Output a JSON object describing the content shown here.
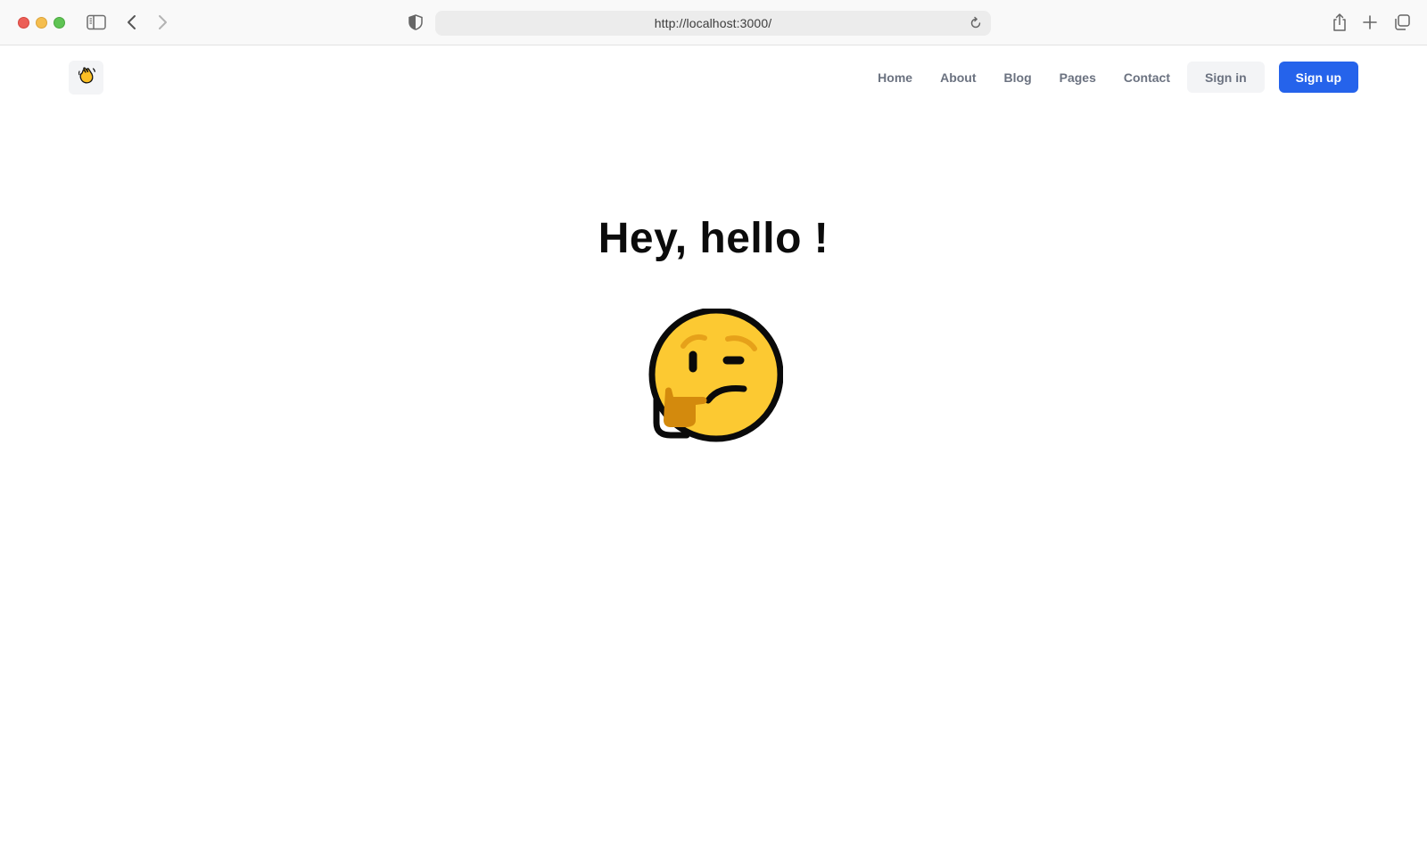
{
  "browser": {
    "url": "http://localhost:3000/",
    "icons": [
      "sidebar-toggle-icon",
      "back-icon",
      "forward-icon",
      "shield-icon",
      "reload-icon",
      "share-icon",
      "new-tab-icon",
      "tabs-overview-icon"
    ]
  },
  "header": {
    "logo_icon": "waving-hand-icon",
    "nav": [
      {
        "label": "Home"
      },
      {
        "label": "About"
      },
      {
        "label": "Blog"
      },
      {
        "label": "Pages"
      },
      {
        "label": "Contact"
      }
    ],
    "signin_label": "Sign in",
    "signup_label": "Sign up"
  },
  "main": {
    "title": "Hey, hello !",
    "emoji_icon": "thinking-face-icon"
  },
  "colors": {
    "primary": "#2563eb",
    "nav_text": "#6b7280",
    "button_bg": "#f3f4f6"
  }
}
